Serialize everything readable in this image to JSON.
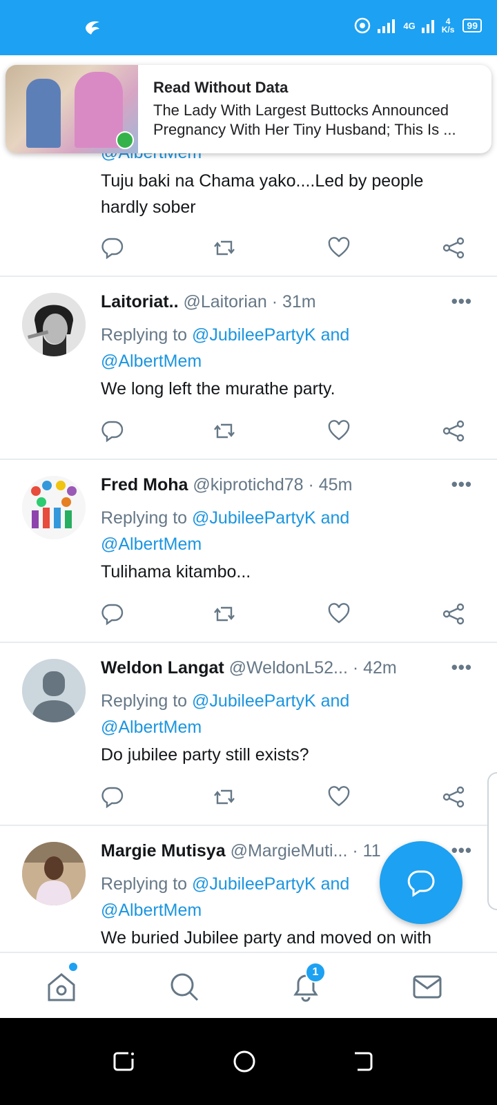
{
  "status_bar": {
    "net_speed_value": "4",
    "net_speed_unit": "K/s",
    "network": "4G",
    "battery": "99"
  },
  "notification": {
    "title": "Read Without Data",
    "text": "The Lady With Largest Buttocks Announced Pregnancy With Her Tiny Husband; This Is ..."
  },
  "tweets": [
    {
      "mention_partial": "@AlbertMem",
      "body": "Tuju baki na Chama yako....Led by people hardly sober"
    },
    {
      "name": "Laitoriat..",
      "handle": "@Laitorian",
      "time": " · 31m",
      "replying_prefix": "Replying to ",
      "mention1": "@JubileePartyK",
      "and": " and",
      "mention2": "@AlbertMem",
      "body": "We long left the murathe party."
    },
    {
      "name": "Fred Moha",
      "handle": "@kiprotichd78",
      "time": " · 45m",
      "replying_prefix": "Replying to ",
      "mention1": "@JubileePartyK",
      "and": " and",
      "mention2": "@AlbertMem",
      "body": "Tulihama kitambo..."
    },
    {
      "name": "Weldon Langat",
      "handle": "@WeldonL52...",
      "time": "  · 42m",
      "replying_prefix": "Replying to ",
      "mention1": "@JubileePartyK",
      "and": " and",
      "mention2": "@AlbertMem",
      "body": "Do jubilee party still exists?"
    },
    {
      "name": "Margie Mutisya",
      "handle": "@MargieMuti...",
      "time": " · 11",
      "replying_prefix": "Replying to ",
      "mention1": "@JubileePartyK",
      "and": " and",
      "mention2": "@AlbertMem",
      "body": "We buried Jubilee party and moved on with"
    }
  ],
  "more_label": "•••",
  "bottom_nav": {
    "notification_count": "1"
  },
  "colors": {
    "accent": "#1da1f2",
    "mention": "#1b95e0",
    "muted": "#657786"
  }
}
